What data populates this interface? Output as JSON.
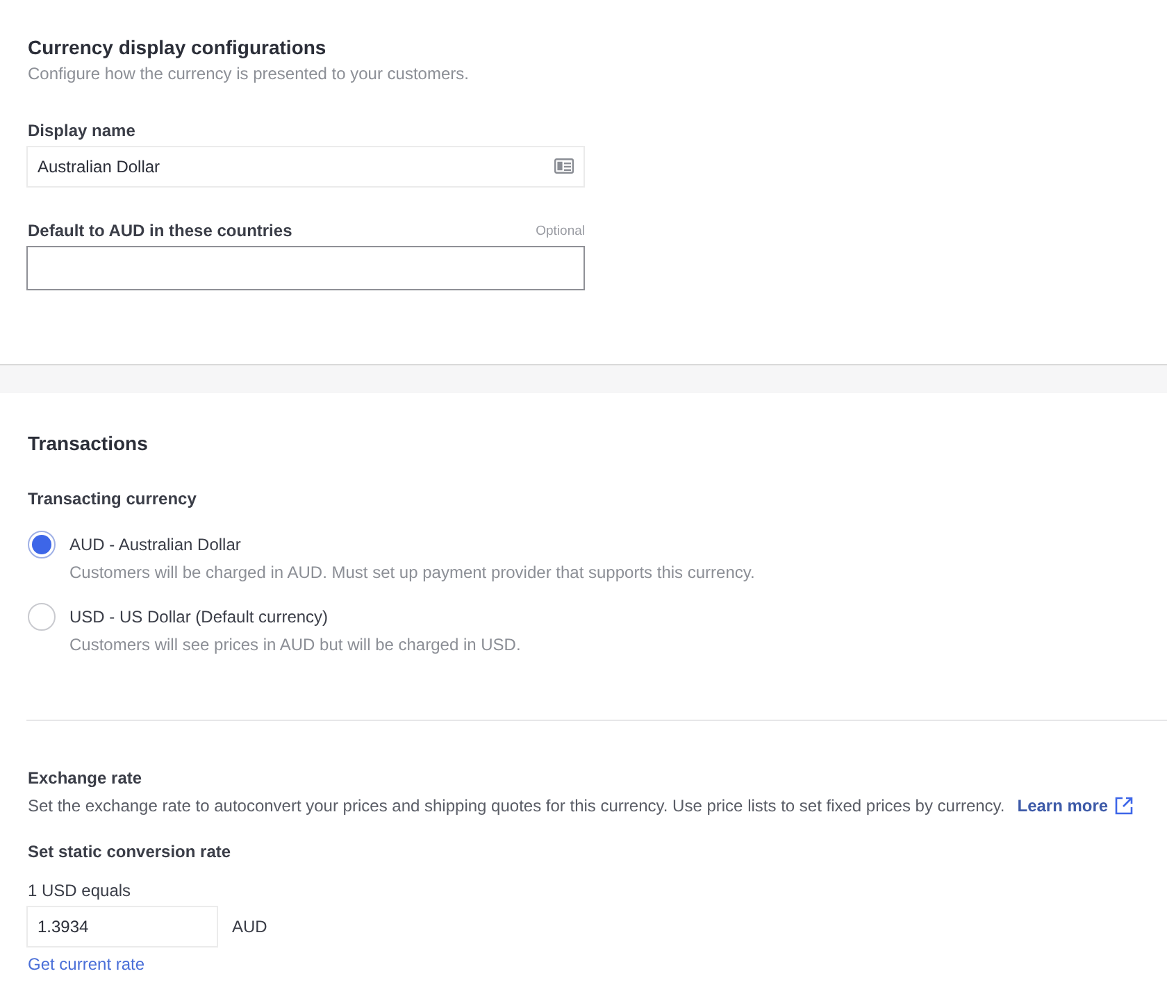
{
  "display_section": {
    "title": "Currency display configurations",
    "subtitle": "Configure how the currency is presented to your customers.",
    "fields": [
      {
        "kind": "name",
        "label": "Display name",
        "value": "Australian Dollar"
      },
      {
        "kind": "countries",
        "label": "Default to AUD in these countries",
        "note": "Optional"
      }
    ]
  },
  "transactions_section": {
    "title": "Transactions",
    "radio_group": {
      "label": "Transacting currency",
      "options": [
        {
          "label": "AUD - Australian Dollar",
          "description": "Customers will be charged in AUD. Must set up payment provider that supports this currency.",
          "selected": true
        },
        {
          "label": "USD - US Dollar (Default currency)",
          "description": "Customers will see prices in AUD but will be charged in USD.",
          "selected": false
        }
      ]
    }
  },
  "exchange_rate": {
    "title": "Exchange rate",
    "description": "Set the exchange rate to autoconvert your prices and shipping quotes for this currency. Use price lists to set fixed prices by currency.",
    "link": "Learn more",
    "conversion": {
      "title": "Set static conversion rate",
      "label": "1 USD equals",
      "value": "1.3934",
      "unit": "AUD",
      "link": "Get current rate"
    }
  }
}
